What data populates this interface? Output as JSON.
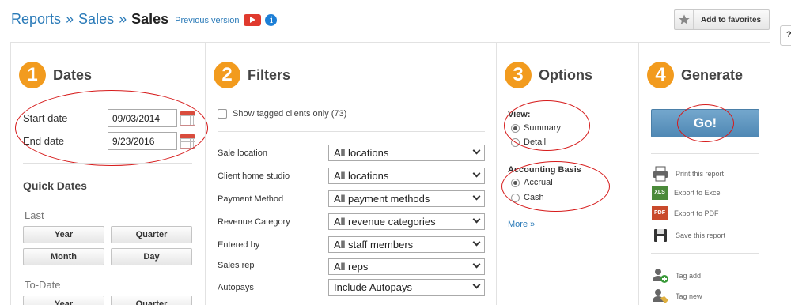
{
  "header": {
    "breadcrumb": [
      "Reports",
      "Sales"
    ],
    "separator": "»",
    "current": "Sales",
    "previous_version": "Previous version",
    "fav_label": "Add to favorites",
    "help_label": "?"
  },
  "dates": {
    "step": "1",
    "title": "Dates",
    "start_label": "Start date",
    "start_value": "09/03/2014",
    "end_label": "End date",
    "end_value": "9/23/2016",
    "quick_title": "Quick Dates",
    "last_label": "Last",
    "last_buttons": [
      "Year",
      "Quarter",
      "Month",
      "Day"
    ],
    "todate_label": "To-Date",
    "todate_buttons": [
      "Year",
      "Quarter"
    ]
  },
  "filters": {
    "step": "2",
    "title": "Filters",
    "tagged_label": "Show tagged clients only (73)",
    "rows": [
      {
        "label": "Sale location",
        "value": "All locations"
      },
      {
        "label": "Client home studio",
        "value": "All locations"
      },
      {
        "label": "Payment Method",
        "value": "All payment methods"
      },
      {
        "label": "Revenue Category",
        "value": "All revenue categories"
      },
      {
        "label": "Entered by",
        "value": "All staff members"
      },
      {
        "label": "Sales rep",
        "value": "All reps"
      },
      {
        "label": "Autopays",
        "value": "Include Autopays"
      }
    ]
  },
  "options": {
    "step": "3",
    "title": "Options",
    "view_label": "View:",
    "view_options": [
      "Summary",
      "Detail"
    ],
    "view_selected": "Summary",
    "basis_label": "Accounting Basis",
    "basis_options": [
      "Accrual",
      "Cash"
    ],
    "basis_selected": "Accrual",
    "more": "More »"
  },
  "generate": {
    "step": "4",
    "title": "Generate",
    "go": "Go!",
    "actions": [
      "Print this report",
      "Export to Excel",
      "Export to PDF",
      "Save this report"
    ],
    "tag_actions": [
      "Tag add",
      "Tag new"
    ],
    "xls_text": "XLS",
    "pdf_text": "PDF"
  },
  "colors": {
    "accent_orange": "#f29b1e",
    "link_blue": "#2a7ab8",
    "annotation_red": "#d61a1a",
    "go_blue": "#5b93bd"
  }
}
